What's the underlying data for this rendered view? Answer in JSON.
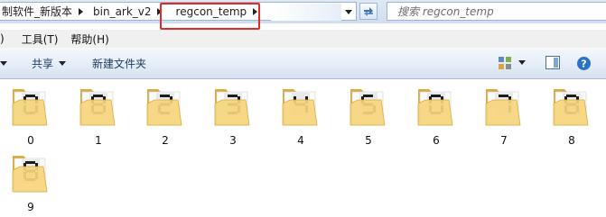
{
  "address_bar": {
    "crumbs": [
      "制软件_新版本",
      "bin_ark_v2",
      "regcon_temp"
    ],
    "refresh_icon": "refresh-icon",
    "dropdown_icon": "chevron-down-icon"
  },
  "search": {
    "placeholder": "搜索 regcon_temp"
  },
  "menu": {
    "partial_label": ")",
    "tools": "工具(T)",
    "help": "帮助(H)"
  },
  "commands": {
    "share": "共享",
    "new_folder": "新建文件夹",
    "views_icon": "change-view-icon",
    "preview_icon": "preview-pane-icon",
    "help_icon": "help-icon"
  },
  "colors": {
    "highlight": "#e32a2a",
    "folder": "#f5d57c",
    "folder_dark": "#d9ac3f"
  },
  "files": [
    {
      "label": "0",
      "digit": "0"
    },
    {
      "label": "1",
      "digit": "8"
    },
    {
      "label": "2",
      "digit": "2"
    },
    {
      "label": "3",
      "digit": "3"
    },
    {
      "label": "4",
      "digit": "4"
    },
    {
      "label": "5",
      "digit": "5"
    },
    {
      "label": "6",
      "digit": "0"
    },
    {
      "label": "7",
      "digit": "7"
    },
    {
      "label": "8",
      "digit": "8"
    },
    {
      "label": "9",
      "digit": "8"
    }
  ]
}
